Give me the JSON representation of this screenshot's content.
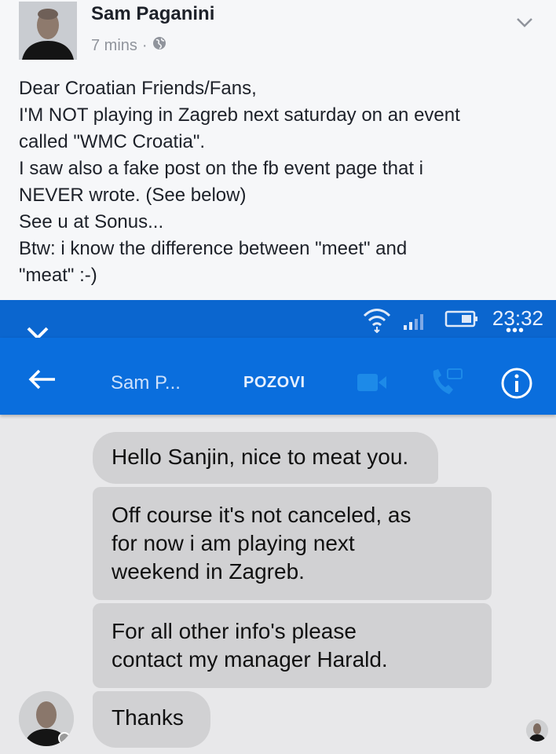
{
  "post": {
    "author": "Sam Paganini",
    "time": "7 mins",
    "separator": "·",
    "privacy_icon": "globe-icon",
    "menu_icon": "chevron-down-icon",
    "lines": [
      "Dear Croatian Friends/Fans,",
      "I'M NOT playing in Zagreb next saturday on an event",
      "called \"WMC Croatia\".",
      "I saw also a fake post on the fb event page that i",
      "NEVER wrote. (See below)",
      "See u at Sonus...",
      "Btw: i know the difference between \"meet\" and",
      "\"meat\" :-)"
    ]
  },
  "screenshot": {
    "status_time": "23:32",
    "overflow_dots": "•••",
    "chat_name": "Sam P...",
    "call_label": "POZOVI",
    "colors": {
      "statusbar": "#0b66cf",
      "toolbar": "#0a6edd",
      "bubble": "#d1d1d3"
    },
    "messages": [
      {
        "lines": [
          "Hello Sanjin, nice to meat you."
        ]
      },
      {
        "lines": [
          "Off course it's not canceled, as",
          "for now i am playing next",
          "weekend in Zagreb."
        ]
      },
      {
        "lines": [
          "For all other info's please",
          "contact my manager Harald."
        ]
      },
      {
        "lines": [
          "Thanks"
        ]
      }
    ]
  }
}
